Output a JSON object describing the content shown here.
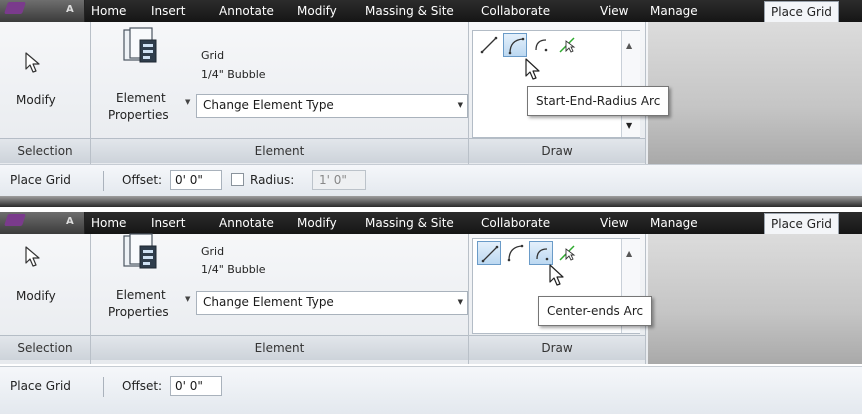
{
  "tabs": [
    "Home",
    "Insert",
    "Annotate",
    "Modify",
    "Massing & Site",
    "Collaborate",
    "View",
    "Manage",
    "Place Grid"
  ],
  "app_button_letter": "A",
  "modify": {
    "label": "Modify"
  },
  "selection_label": "Selection",
  "element": {
    "properties_line1": "Element",
    "properties_line2": "Properties",
    "type_name": "Grid",
    "type_size": "1/4\" Bubble",
    "change_type": "Change Element Type",
    "panel_label": "Element"
  },
  "draw": {
    "panel_label": "Draw",
    "tools": [
      "line-icon",
      "start-end-radius-arc-icon",
      "center-ends-arc-icon",
      "pick-lines-icon"
    ]
  },
  "panels": [
    {
      "tooltip": "Start-End-Radius Arc",
      "options": {
        "title": "Place Grid",
        "offset_label": "Offset:",
        "offset_value": "0'  0\"",
        "radius_label": "Radius:",
        "radius_value": "1'  0\""
      }
    },
    {
      "tooltip": "Center-ends Arc",
      "options": {
        "title": "Place Grid",
        "offset_label": "Offset:",
        "offset_value": "0'  0\""
      }
    }
  ],
  "colors": {
    "tab_bar": "#1e1e1e",
    "highlight": "#bcd8f1",
    "draw_green": "#2eaa2e"
  }
}
